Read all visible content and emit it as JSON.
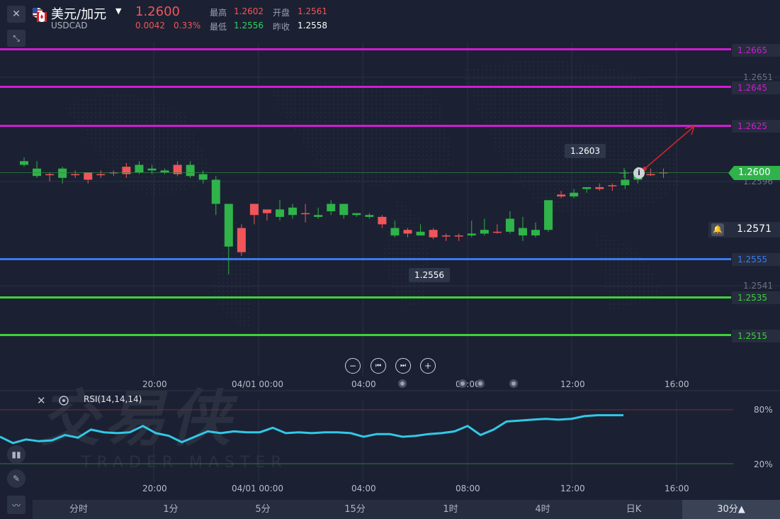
{
  "header": {
    "symbol": "美元/加元",
    "code": "USDCAD",
    "price": "1.2600",
    "change": "0.0042",
    "change_pct": "0.33%",
    "high_label": "最高",
    "high": "1.2602",
    "open_label": "开盘",
    "open": "1.2561",
    "low_label": "最低",
    "low": "1.2556",
    "prev_close_label": "昨收",
    "prev_close": "1.2558"
  },
  "price_levels": [
    {
      "value": "1.2665",
      "color": "#d21bd3"
    },
    {
      "value": "1.2645",
      "color": "#d21bd3"
    },
    {
      "value": "1.2625",
      "color": "#d21bd3"
    },
    {
      "value": "1.2555",
      "color": "#3a7bf2"
    },
    {
      "value": "1.2535",
      "color": "#3dd23a"
    },
    {
      "value": "1.2515",
      "color": "#3dd23a"
    }
  ],
  "axis_labels": [
    "1.2651",
    "1.2596",
    "1.2541"
  ],
  "current_price_tag": "1.2600",
  "alert_price": "1.2571",
  "bubbles": {
    "high": "1.2603",
    "low": "1.2556"
  },
  "time_labels": [
    "20:00",
    "04/01 00:00",
    "04:00",
    "08:00",
    "12:00",
    "16:00"
  ],
  "rsi": {
    "title": "RSI(14,14,14)",
    "levels": [
      "80%",
      "20%"
    ],
    "values": [
      50,
      43,
      47,
      45,
      46,
      52,
      49,
      58,
      55,
      54,
      55,
      62,
      54,
      51,
      44,
      50,
      56,
      54,
      56,
      55,
      55,
      60,
      54,
      55,
      54,
      55,
      55,
      54,
      50,
      53,
      53,
      50,
      51,
      53,
      54,
      56,
      62,
      52,
      58,
      67,
      68,
      69,
      70,
      69,
      70,
      73,
      74,
      74,
      74
    ]
  },
  "watermark": {
    "main": "交易侠",
    "sub": "TRADER MASTER"
  },
  "chart_data": {
    "type": "candlestick",
    "y_range": [
      1.251,
      1.267
    ],
    "candles": [
      {
        "o": 1.2606,
        "h": 1.2608,
        "l": 1.2603,
        "c": 1.2604
      },
      {
        "o": 1.2602,
        "h": 1.2606,
        "l": 1.2597,
        "c": 1.2598
      },
      {
        "o": 1.2599,
        "h": 1.26,
        "l": 1.2595,
        "c": 1.2599
      },
      {
        "o": 1.2602,
        "h": 1.2603,
        "l": 1.2594,
        "c": 1.2597
      },
      {
        "o": 1.2599,
        "h": 1.2601,
        "l": 1.2597,
        "c": 1.2599
      },
      {
        "o": 1.2596,
        "h": 1.26,
        "l": 1.2594,
        "c": 1.26
      },
      {
        "o": 1.2599,
        "h": 1.2601,
        "l": 1.2597,
        "c": 1.2599
      },
      {
        "o": 1.26,
        "h": 1.2601,
        "l": 1.2598,
        "c": 1.26
      },
      {
        "o": 1.2599,
        "h": 1.2605,
        "l": 1.2597,
        "c": 1.2603
      },
      {
        "o": 1.2604,
        "h": 1.2606,
        "l": 1.2599,
        "c": 1.26
      },
      {
        "o": 1.2602,
        "h": 1.2604,
        "l": 1.2599,
        "c": 1.2601
      },
      {
        "o": 1.2601,
        "h": 1.2602,
        "l": 1.2599,
        "c": 1.26
      },
      {
        "o": 1.2599,
        "h": 1.2606,
        "l": 1.2598,
        "c": 1.2604
      },
      {
        "o": 1.2604,
        "h": 1.2606,
        "l": 1.2597,
        "c": 1.2598
      },
      {
        "o": 1.2599,
        "h": 1.2601,
        "l": 1.2594,
        "c": 1.2596
      },
      {
        "o": 1.2596,
        "h": 1.2598,
        "l": 1.2577,
        "c": 1.2583
      },
      {
        "o": 1.2583,
        "h": 1.2583,
        "l": 1.2545,
        "c": 1.256
      },
      {
        "o": 1.2557,
        "h": 1.2572,
        "l": 1.2555,
        "c": 1.257
      },
      {
        "o": 1.2577,
        "h": 1.2583,
        "l": 1.2572,
        "c": 1.2583
      },
      {
        "o": 1.2578,
        "h": 1.258,
        "l": 1.2574,
        "c": 1.258
      },
      {
        "o": 1.258,
        "h": 1.2585,
        "l": 1.2574,
        "c": 1.2576
      },
      {
        "o": 1.2581,
        "h": 1.2583,
        "l": 1.2575,
        "c": 1.2577
      },
      {
        "o": 1.2578,
        "h": 1.2583,
        "l": 1.2573,
        "c": 1.2578
      },
      {
        "o": 1.2577,
        "h": 1.2581,
        "l": 1.2575,
        "c": 1.2576
      },
      {
        "o": 1.2583,
        "h": 1.2585,
        "l": 1.2577,
        "c": 1.2579
      },
      {
        "o": 1.2583,
        "h": 1.2583,
        "l": 1.2575,
        "c": 1.2577
      },
      {
        "o": 1.2578,
        "h": 1.2578,
        "l": 1.2576,
        "c": 1.2577
      },
      {
        "o": 1.2577,
        "h": 1.2578,
        "l": 1.2575,
        "c": 1.2576
      },
      {
        "o": 1.2572,
        "h": 1.2577,
        "l": 1.257,
        "c": 1.2576
      },
      {
        "o": 1.257,
        "h": 1.2574,
        "l": 1.2565,
        "c": 1.2566
      },
      {
        "o": 1.2567,
        "h": 1.257,
        "l": 1.2565,
        "c": 1.2569
      },
      {
        "o": 1.2568,
        "h": 1.2572,
        "l": 1.2566,
        "c": 1.2566
      },
      {
        "o": 1.2565,
        "h": 1.257,
        "l": 1.2564,
        "c": 1.2569
      },
      {
        "o": 1.2566,
        "h": 1.2567,
        "l": 1.2563,
        "c": 1.2566
      },
      {
        "o": 1.2566,
        "h": 1.2567,
        "l": 1.2563,
        "c": 1.2566
      },
      {
        "o": 1.2567,
        "h": 1.2574,
        "l": 1.2565,
        "c": 1.2566
      },
      {
        "o": 1.2569,
        "h": 1.2575,
        "l": 1.2566,
        "c": 1.2567
      },
      {
        "o": 1.2568,
        "h": 1.2572,
        "l": 1.2567,
        "c": 1.2568
      },
      {
        "o": 1.2575,
        "h": 1.2579,
        "l": 1.2567,
        "c": 1.2568
      },
      {
        "o": 1.257,
        "h": 1.2576,
        "l": 1.2563,
        "c": 1.2566
      },
      {
        "o": 1.2569,
        "h": 1.2573,
        "l": 1.2565,
        "c": 1.2566
      },
      {
        "o": 1.2585,
        "h": 1.2585,
        "l": 1.2568,
        "c": 1.2569
      },
      {
        "o": 1.2587,
        "h": 1.259,
        "l": 1.2586,
        "c": 1.2588
      },
      {
        "o": 1.2589,
        "h": 1.2591,
        "l": 1.2586,
        "c": 1.2587
      },
      {
        "o": 1.2592,
        "h": 1.2592,
        "l": 1.2589,
        "c": 1.2591
      },
      {
        "o": 1.2591,
        "h": 1.2594,
        "l": 1.259,
        "c": 1.2592
      },
      {
        "o": 1.2593,
        "h": 1.2594,
        "l": 1.259,
        "c": 1.2593
      },
      {
        "o": 1.2596,
        "h": 1.2601,
        "l": 1.2591,
        "c": 1.2593
      },
      {
        "o": 1.2599,
        "h": 1.2603,
        "l": 1.2594,
        "c": 1.2596
      },
      {
        "o": 1.2599,
        "h": 1.2602,
        "l": 1.2598,
        "c": 1.2599
      },
      {
        "o": 1.26,
        "h": 1.2602,
        "l": 1.2597,
        "c": 1.26
      }
    ],
    "up_color": "#f0555a",
    "down_color": "#2fb34a"
  },
  "tabs": [
    "分时",
    "1分",
    "5分",
    "15分",
    "1时",
    "4时",
    "日K",
    "30分▲"
  ],
  "colors": {
    "bg": "#1b2132",
    "up": "#f0555a",
    "down": "#2fb34a",
    "rsi_line": "#32c8e6",
    "current_price": "#2fb34a"
  }
}
